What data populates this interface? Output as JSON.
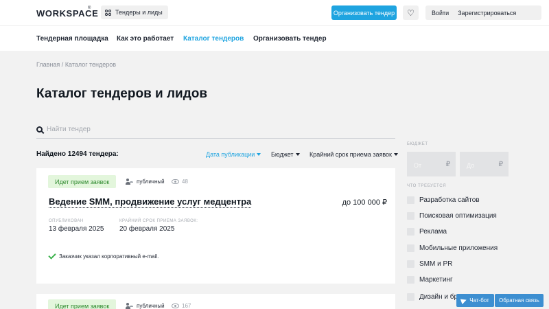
{
  "header": {
    "logo": "WORKSPACE",
    "logo_mark": "®",
    "catalog_button": "Тендеры и лиды",
    "organize_button": "Организовать тендер",
    "login": "Войти",
    "register": "Зарегистрироваться",
    "favorites_icon": "heart-icon"
  },
  "nav": {
    "items": [
      {
        "label": "Тендерная площадка",
        "active": false
      },
      {
        "label": "Как это работает",
        "active": false
      },
      {
        "label": "Каталог тендеров",
        "active": true
      },
      {
        "label": "Организовать тендер",
        "active": false
      }
    ]
  },
  "breadcrumb": {
    "home": "Главная",
    "separator": "/",
    "current": "Каталог тендеров"
  },
  "page_title": "Каталог тендеров и лидов",
  "search": {
    "placeholder": "Найти тендер",
    "value": ""
  },
  "results": {
    "found_text": "Найдено 12494 тендера:"
  },
  "sort": {
    "items": [
      {
        "label": "Дата публикации",
        "active": true
      },
      {
        "label": "Бюджет",
        "active": false
      },
      {
        "label": "Крайний срок приема заявок",
        "active": false
      }
    ]
  },
  "cards": [
    {
      "status": "Идет прием заявок",
      "visibility": "публичный",
      "views": "48",
      "title": "Ведение SMM, продвижение услуг медцентра",
      "price": "до 100 000 ₽",
      "published_label": "Опубликован",
      "published_value": "13 февраля 2025",
      "deadline_label": "Крайний срок приема заявок:",
      "deadline_value": "20 февраля 2025",
      "verified_text": "Заказчик указал корпоративный e-mail."
    },
    {
      "status": "Идет прием заявок",
      "visibility": "публичный",
      "views": "167"
    }
  ],
  "sidebar": {
    "budget_label": "Бюджет",
    "budget_from": "От",
    "budget_to": "До",
    "currency": "₽",
    "needs_label": "Что требуется",
    "needs": [
      {
        "label": "Разработка сайтов",
        "checked": false
      },
      {
        "label": "Поисковая оптимизация",
        "checked": false
      },
      {
        "label": "Реклама",
        "checked": false
      },
      {
        "label": "Мобильные приложения",
        "checked": false
      },
      {
        "label": "SMM и PR",
        "checked": false
      },
      {
        "label": "Маркетинг",
        "checked": false
      },
      {
        "label": "Дизайн и брендинг",
        "checked": false
      }
    ]
  },
  "chat": {
    "chatbot": "Чат-бот",
    "feedback": "Обратная связь"
  },
  "colors": {
    "accent": "#1fa4e0",
    "status_bg": "#e3f6dc",
    "status_text": "#2f8a2f",
    "chat": "#3d8fd1"
  }
}
